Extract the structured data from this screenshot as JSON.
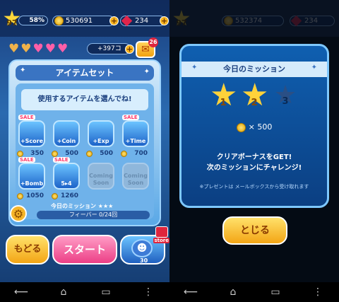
{
  "left": {
    "level": "97",
    "exp_percent": "58%",
    "coins": "530691",
    "gems": "234",
    "hearts_extra": "+397コ",
    "mail_badge": "26",
    "panel_title": "アイテムセット",
    "prompt": "使用するアイテムを選んでね!",
    "sale_label": "SALE",
    "items": [
      {
        "label": "+Score",
        "price": "350",
        "sale": true
      },
      {
        "label": "+Coin",
        "price": "500",
        "sale": false
      },
      {
        "label": "+Exp",
        "price": "500",
        "sale": false
      },
      {
        "label": "+Time",
        "price": "700",
        "sale": true
      },
      {
        "label": "+Bomb",
        "price": "1050",
        "sale": true
      },
      {
        "label": "5▸4",
        "price": "1260",
        "sale": true
      },
      {
        "label": "Coming Soon"
      },
      {
        "label": "Coming Soon"
      }
    ],
    "mission_label": "今日のミッション ★★★",
    "fever": "フィーバー 0/24回",
    "back_button": "もどる",
    "start_button": "スタート",
    "store_label": "store",
    "store_count": "30"
  },
  "right": {
    "level": "97",
    "coins": "532374",
    "gems": "234",
    "title": "今日のミッション",
    "stars": [
      "1",
      "2",
      "3"
    ],
    "reward": "× 500",
    "clear_line1": "クリアボーナスをGET!",
    "clear_line2": "次のミッションにチャレンジ!",
    "note": "※プレゼントは メールボックスから受け取れます",
    "close_button": "とじる"
  },
  "colors": {
    "accent_blue": "#2a6ab0",
    "start_pink": "#ec3f86",
    "yellow_button": "#f3a515",
    "star_gold": "#ffd23a"
  }
}
